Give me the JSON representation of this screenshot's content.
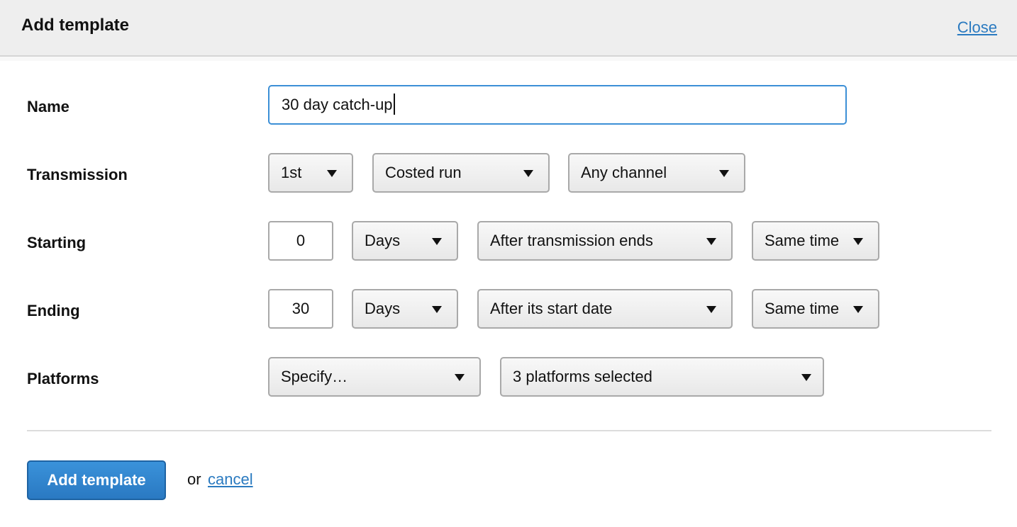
{
  "dialog": {
    "title": "Add template",
    "close_label": "Close"
  },
  "form": {
    "name": {
      "label": "Name",
      "value": "30 day catch-up"
    },
    "transmission": {
      "label": "Transmission",
      "occurrence": "1st",
      "run_type": "Costed run",
      "channel": "Any channel"
    },
    "starting": {
      "label": "Starting",
      "amount": "0",
      "unit": "Days",
      "relative_to": "After transmission ends",
      "time": "Same time"
    },
    "ending": {
      "label": "Ending",
      "amount": "30",
      "unit": "Days",
      "relative_to": "After its start date",
      "time": "Same time"
    },
    "platforms": {
      "label": "Platforms",
      "mode": "Specify…",
      "selection": "3 platforms selected"
    }
  },
  "footer": {
    "submit_label": "Add template",
    "or_text": "or",
    "cancel_label": "cancel"
  },
  "colors": {
    "link": "#2a7ac0",
    "primary": "#2f82cc",
    "focus_border": "#3c8fd6"
  }
}
